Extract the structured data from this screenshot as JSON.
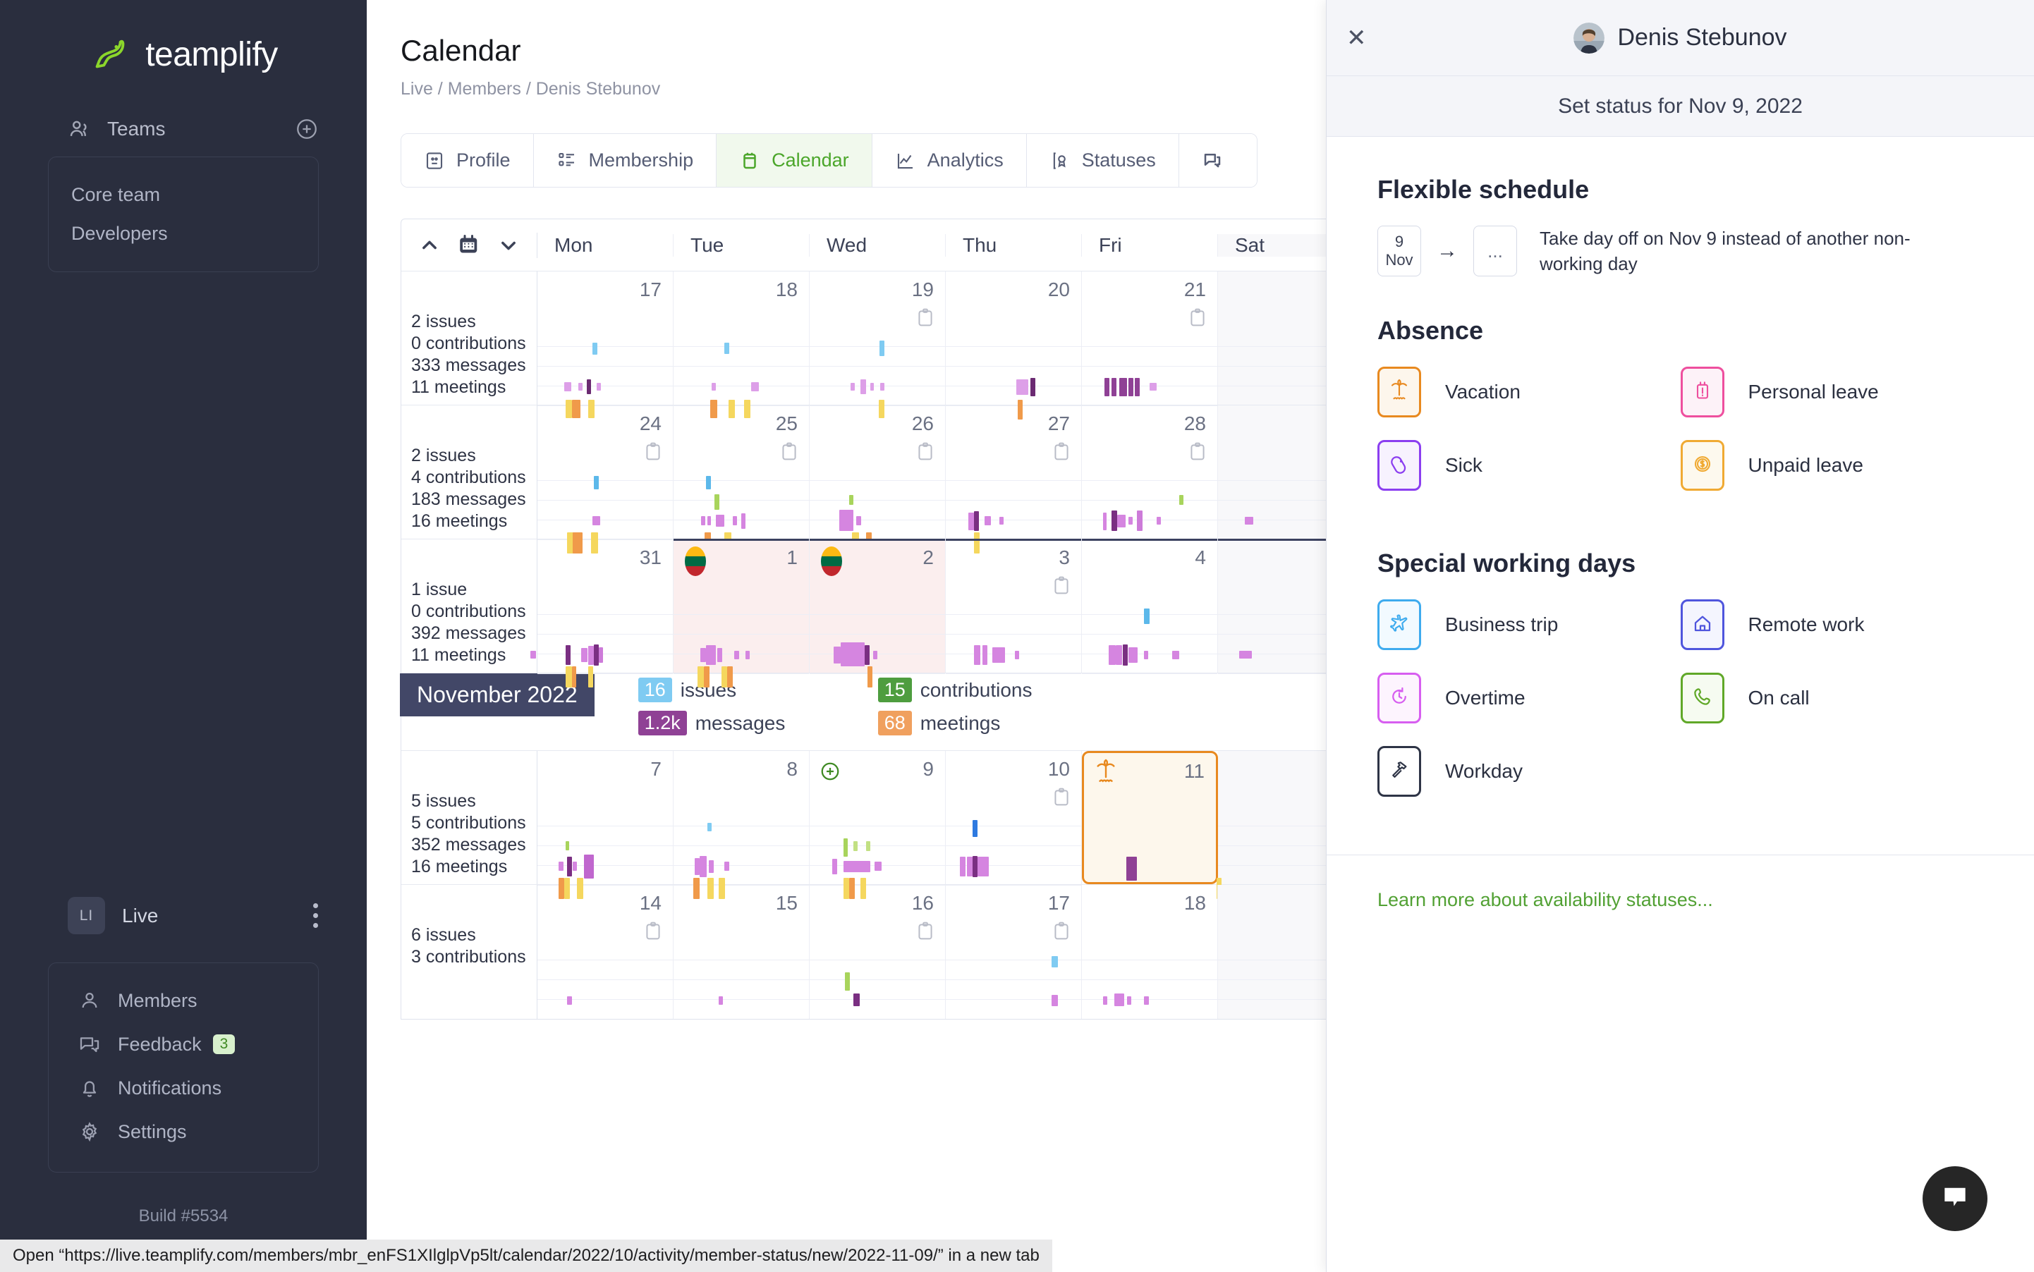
{
  "sidebar": {
    "brand": "teamplify",
    "teams_label": "Teams",
    "teams": [
      "Core team",
      "Developers"
    ],
    "workspace_initials": "LI",
    "workspace_name": "Live",
    "menu": [
      {
        "label": "Members",
        "icon": "user-icon",
        "badge": ""
      },
      {
        "label": "Feedback",
        "icon": "comment-icon",
        "badge": "3"
      },
      {
        "label": "Notifications",
        "icon": "bell-icon",
        "badge": ""
      },
      {
        "label": "Settings",
        "icon": "gear-icon",
        "badge": ""
      }
    ],
    "build": "Build #5534"
  },
  "header": {
    "title": "Calendar",
    "breadcrumb": "Live / Members / Denis Stebunov",
    "tabs": [
      {
        "label": "Profile",
        "icon": "id-card-icon",
        "active": false
      },
      {
        "label": "Membership",
        "icon": "list-icon",
        "active": false
      },
      {
        "label": "Calendar",
        "icon": "calendar-icon",
        "active": true
      },
      {
        "label": "Analytics",
        "icon": "chart-icon",
        "active": false
      },
      {
        "label": "Statuses",
        "icon": "badge-icon",
        "active": false
      },
      {
        "label": "",
        "icon": "comment-icon",
        "active": false
      }
    ]
  },
  "calendar": {
    "dow": [
      "Mon",
      "Tue",
      "Wed",
      "Thu",
      "Fri",
      "Sat"
    ],
    "month_chip": "November 2022",
    "month_stats": [
      {
        "value": "16",
        "label": "issues",
        "color": "#7fcbf2"
      },
      {
        "value": "15",
        "label": "contributions",
        "color": "#4e9d3f"
      },
      {
        "value": "1.2k",
        "label": "messages",
        "color": "#8f4195"
      },
      {
        "value": "68",
        "label": "meetings",
        "color": "#f0a05e"
      }
    ],
    "weeks": [
      {
        "stats": [
          "2 issues",
          "0 contributions",
          "333 messages",
          "11 meetings"
        ],
        "days": [
          {
            "num": "17",
            "doc": false
          },
          {
            "num": "18",
            "doc": false
          },
          {
            "num": "19",
            "doc": true
          },
          {
            "num": "20",
            "doc": false
          },
          {
            "num": "21",
            "doc": true
          },
          {
            "num": "",
            "doc": false
          }
        ]
      },
      {
        "stats": [
          "2 issues",
          "4 contributions",
          "183 messages",
          "16 meetings"
        ],
        "days": [
          {
            "num": "24",
            "doc": true
          },
          {
            "num": "25",
            "doc": true
          },
          {
            "num": "26",
            "doc": true
          },
          {
            "num": "27",
            "doc": true
          },
          {
            "num": "28",
            "doc": true
          },
          {
            "num": "",
            "doc": false
          }
        ]
      },
      {
        "stats": [
          "1 issue",
          "0 contributions",
          "392 messages",
          "11 meetings"
        ],
        "days": [
          {
            "num": "31",
            "doc": false
          },
          {
            "num": "1",
            "doc": false,
            "flag": true,
            "selected": true
          },
          {
            "num": "2",
            "doc": false,
            "flag": true,
            "selected": true
          },
          {
            "num": "3",
            "doc": true
          },
          {
            "num": "4",
            "doc": false
          },
          {
            "num": "",
            "doc": false
          }
        ]
      },
      {
        "stats": [
          "5 issues",
          "5 contributions",
          "352 messages",
          "16 meetings"
        ],
        "days": [
          {
            "num": "7",
            "doc": false
          },
          {
            "num": "8",
            "doc": false
          },
          {
            "num": "9",
            "doc": false,
            "plus": true
          },
          {
            "num": "10",
            "doc": true
          },
          {
            "num": "11",
            "doc": false,
            "vacation": true
          },
          {
            "num": "",
            "doc": false
          }
        ]
      },
      {
        "stats": [
          "6 issues",
          "3 contributions",
          "",
          ""
        ],
        "days": [
          {
            "num": "14",
            "doc": true
          },
          {
            "num": "15",
            "doc": false
          },
          {
            "num": "16",
            "doc": true
          },
          {
            "num": "17",
            "doc": true
          },
          {
            "num": "18",
            "doc": false
          },
          {
            "num": "",
            "doc": false
          }
        ]
      }
    ]
  },
  "panel": {
    "user_name": "Denis Stebunov",
    "subtitle": "Set status for Nov 9, 2022",
    "flexible": {
      "title": "Flexible schedule",
      "date_day": "9",
      "date_month": "Nov",
      "arrow": "→",
      "target": "...",
      "description": "Take day off on Nov 9 instead of another non-working day"
    },
    "absence": {
      "title": "Absence",
      "options": [
        {
          "label": "Vacation",
          "icon": "palm-tree-icon",
          "color": "#e8891f",
          "bg": "#fdf6ec"
        },
        {
          "label": "Personal leave",
          "icon": "exclamation-doc-icon",
          "color": "#ee4f9e",
          "bg": "#fdf2f8"
        },
        {
          "label": "Sick",
          "icon": "pill-icon",
          "color": "#8b3ef0",
          "bg": "#f7f2fe"
        },
        {
          "label": "Unpaid leave",
          "icon": "dollar-coin-icon",
          "color": "#f0aa33",
          "bg": "#fdf9ee"
        }
      ]
    },
    "special": {
      "title": "Special working days",
      "options": [
        {
          "label": "Business trip",
          "icon": "airplane-icon",
          "color": "#3eabee",
          "bg": "#f2faff"
        },
        {
          "label": "Remote work",
          "icon": "home-icon",
          "color": "#4f55dd",
          "bg": "#f4f5fe"
        },
        {
          "label": "Overtime",
          "icon": "clock-plus-icon",
          "color": "#d75ef0",
          "bg": "#fdf4fe"
        },
        {
          "label": "On call",
          "icon": "phone-icon",
          "color": "#60a828",
          "bg": "#f6fbf1"
        },
        {
          "label": "Workday",
          "icon": "hammer-icon",
          "color": "#2e3446",
          "bg": "#ffffff"
        }
      ]
    },
    "learn_more": "Learn more about availability statuses..."
  },
  "statusbar": {
    "text": "Open “https://live.teamplify.com/members/mbr_enFS1XIlglpVp5lt/calendar/2022/10/activity/member-status/new/2022-11-09/” in a new tab"
  },
  "chat": {
    "icon": "chat-bubble-icon"
  }
}
